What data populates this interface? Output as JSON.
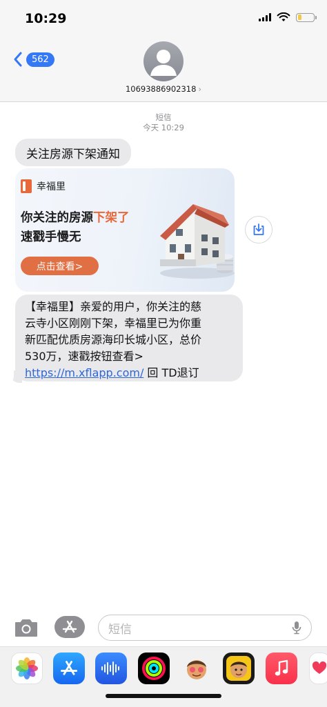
{
  "status_bar": {
    "time": "10:29"
  },
  "header": {
    "back_badge": "562",
    "contact_number": "10693886902318"
  },
  "thread": {
    "service": "短信",
    "timestamp": "今天 10:29",
    "title_message": "关注房源下架通知",
    "card": {
      "brand": "幸福里",
      "headline_part1": "你关注的房源",
      "headline_highlight": "下架了",
      "headline_line2": "速戳手慢无",
      "button_label": "点击查看>"
    },
    "body_lines": [
      "【幸福里】亲爱的用户，你关注的慈",
      "云寺小区刚刚下架，幸福里已为你重",
      "新匹配优质房源海印长城小区，总价",
      "530万，速戳按钮查看>"
    ],
    "link_text": "https://m.xflapp.com/",
    "unsubscribe_text": " 回 TD退订"
  },
  "composer": {
    "placeholder": "短信"
  },
  "app_drawer": {
    "apps": [
      "photos-icon",
      "app-store-icon",
      "audio-icon",
      "activity-icon",
      "memoji-icon",
      "animoji-icon",
      "music-icon",
      "heart-icon"
    ]
  },
  "colors": {
    "accent": "#3478f6",
    "brand_orange": "#e8683a",
    "bubble": "#e9e9eb",
    "link": "#2d66d6"
  }
}
